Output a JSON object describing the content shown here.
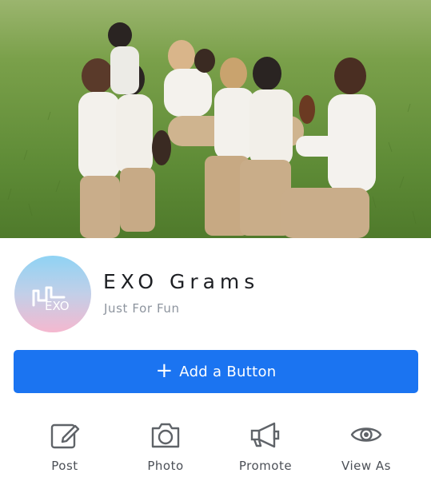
{
  "page": {
    "name": "EXO Grams",
    "category": "Just For Fun"
  },
  "avatar": {
    "logo_text": "EXO",
    "gradient_colors": [
      "#8fd3f4",
      "#f5b8cf"
    ]
  },
  "primary_button": {
    "label": "Add a Button",
    "icon": "plus-icon",
    "color": "#1b74f1"
  },
  "actions": [
    {
      "label": "Post",
      "icon": "edit-icon"
    },
    {
      "label": "Photo",
      "icon": "camera-icon"
    },
    {
      "label": "Promote",
      "icon": "megaphone-icon"
    },
    {
      "label": "View As",
      "icon": "eye-icon"
    }
  ],
  "cover_photo": {
    "description_icon": "cover-photo"
  }
}
